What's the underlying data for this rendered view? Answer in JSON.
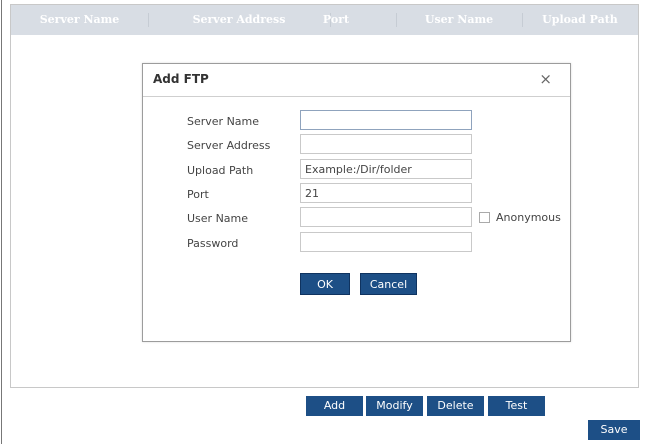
{
  "table": {
    "columns": [
      "Server Name",
      "Server Address",
      "Port",
      "User Name",
      "Upload Path"
    ]
  },
  "dialog": {
    "title": "Add FTP",
    "close_symbol": "×",
    "fields": {
      "server_name": {
        "label": "Server Name",
        "value": "",
        "placeholder": ""
      },
      "server_address": {
        "label": "Server Address",
        "value": "",
        "placeholder": ""
      },
      "upload_path": {
        "label": "Upload Path",
        "value": "Example:/Dir/folder",
        "placeholder": ""
      },
      "port": {
        "label": "Port",
        "value": "21",
        "placeholder": ""
      },
      "user_name": {
        "label": "User Name",
        "value": "",
        "placeholder": ""
      },
      "password": {
        "label": "Password",
        "value": "",
        "placeholder": ""
      }
    },
    "anonymous_label": "Anonymous",
    "anonymous_checked": false,
    "ok_label": "OK",
    "cancel_label": "Cancel"
  },
  "actions": {
    "add_label": "Add",
    "modify_label": "Modify",
    "delete_label": "Delete",
    "test_label": "Test",
    "save_label": "Save"
  },
  "colors": {
    "button_bg": "#1d4f86",
    "header_bg": "#d8dde4"
  }
}
